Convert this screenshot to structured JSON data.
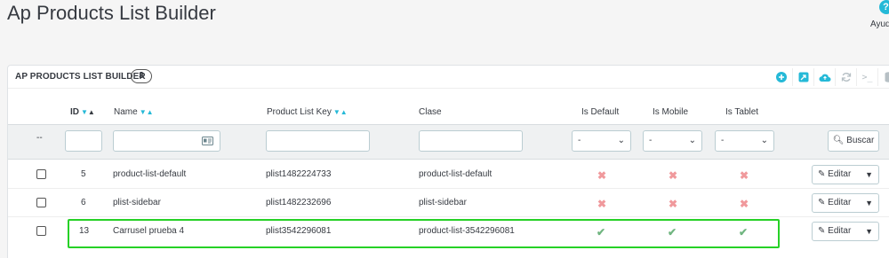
{
  "page": {
    "title": "Ap Products List Builder",
    "help_label": "Ayud",
    "help_icon": "?"
  },
  "panel": {
    "title": "AP PRODUCTS LIST BUILDER",
    "count": "3"
  },
  "toolbar": {
    "icons": [
      "add-icon",
      "export-icon",
      "cloud-upload-icon",
      "refresh-icon",
      "terminal-icon",
      "database-icon"
    ],
    "terminal_text": ">_"
  },
  "columns": {
    "id": "ID",
    "name": "Name",
    "key": "Product List Key",
    "clase": "Clase",
    "is_default": "Is Default",
    "is_mobile": "Is Mobile",
    "is_tablet": "Is Tablet"
  },
  "filters": {
    "dashdash": "--",
    "default_value": "-",
    "mobile_value": "-",
    "tablet_value": "-",
    "search_label": "Buscar"
  },
  "rows": [
    {
      "id": "5",
      "name": "product-list-default",
      "key": "plist1482224733",
      "clase": "product-list-default",
      "is_default": "✖",
      "is_mobile": "✖",
      "is_tablet": "✖",
      "action": "Editar"
    },
    {
      "id": "6",
      "name": "plist-sidebar",
      "key": "plist1482232696",
      "clase": "plist-sidebar",
      "is_default": "✖",
      "is_mobile": "✖",
      "is_tablet": "✖",
      "action": "Editar"
    },
    {
      "id": "13",
      "name": "Carrusel prueba 4",
      "key": "plist3542296081",
      "clase": "product-list-3542296081",
      "is_default": "✔",
      "is_mobile": "✔",
      "is_tablet": "✔",
      "action": "Editar"
    }
  ],
  "colors": {
    "accent": "#25b9d7",
    "enabled": "#70b580",
    "disabled": "#f0999c",
    "highlight": "#26d126"
  }
}
